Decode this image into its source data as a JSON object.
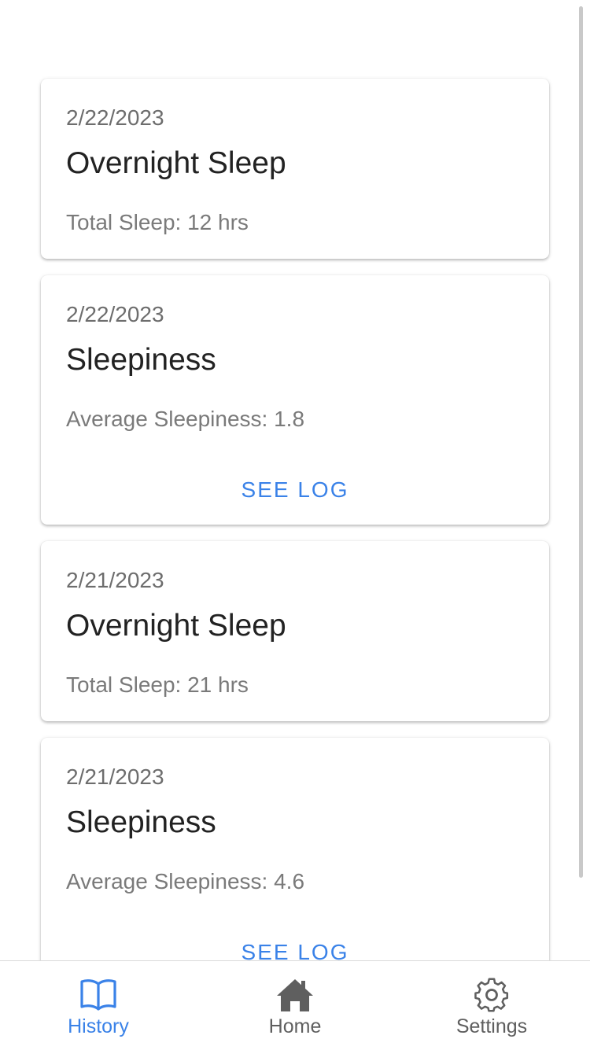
{
  "cards": [
    {
      "date": "2/22/2023",
      "title": "Overnight Sleep",
      "detail": "Total Sleep: 12 hrs"
    },
    {
      "date": "2/22/2023",
      "title": "Sleepiness",
      "detail": "Average Sleepiness: 1.8",
      "action": "SEE LOG"
    },
    {
      "date": "2/21/2023",
      "title": "Overnight Sleep",
      "detail": "Total Sleep: 21 hrs"
    },
    {
      "date": "2/21/2023",
      "title": "Sleepiness",
      "detail": "Average Sleepiness: 4.6",
      "action": "SEE LOG"
    }
  ],
  "tabbar": {
    "tabs": [
      {
        "label": "History",
        "icon": "book-icon",
        "active": true
      },
      {
        "label": "Home",
        "icon": "home-icon",
        "active": false
      },
      {
        "label": "Settings",
        "icon": "gear-icon",
        "active": false
      }
    ]
  },
  "colors": {
    "accent": "#3a82e8",
    "inactive_tab": "#5f5f5f",
    "title_text": "#222222",
    "secondary_text": "#6d6d6d"
  }
}
